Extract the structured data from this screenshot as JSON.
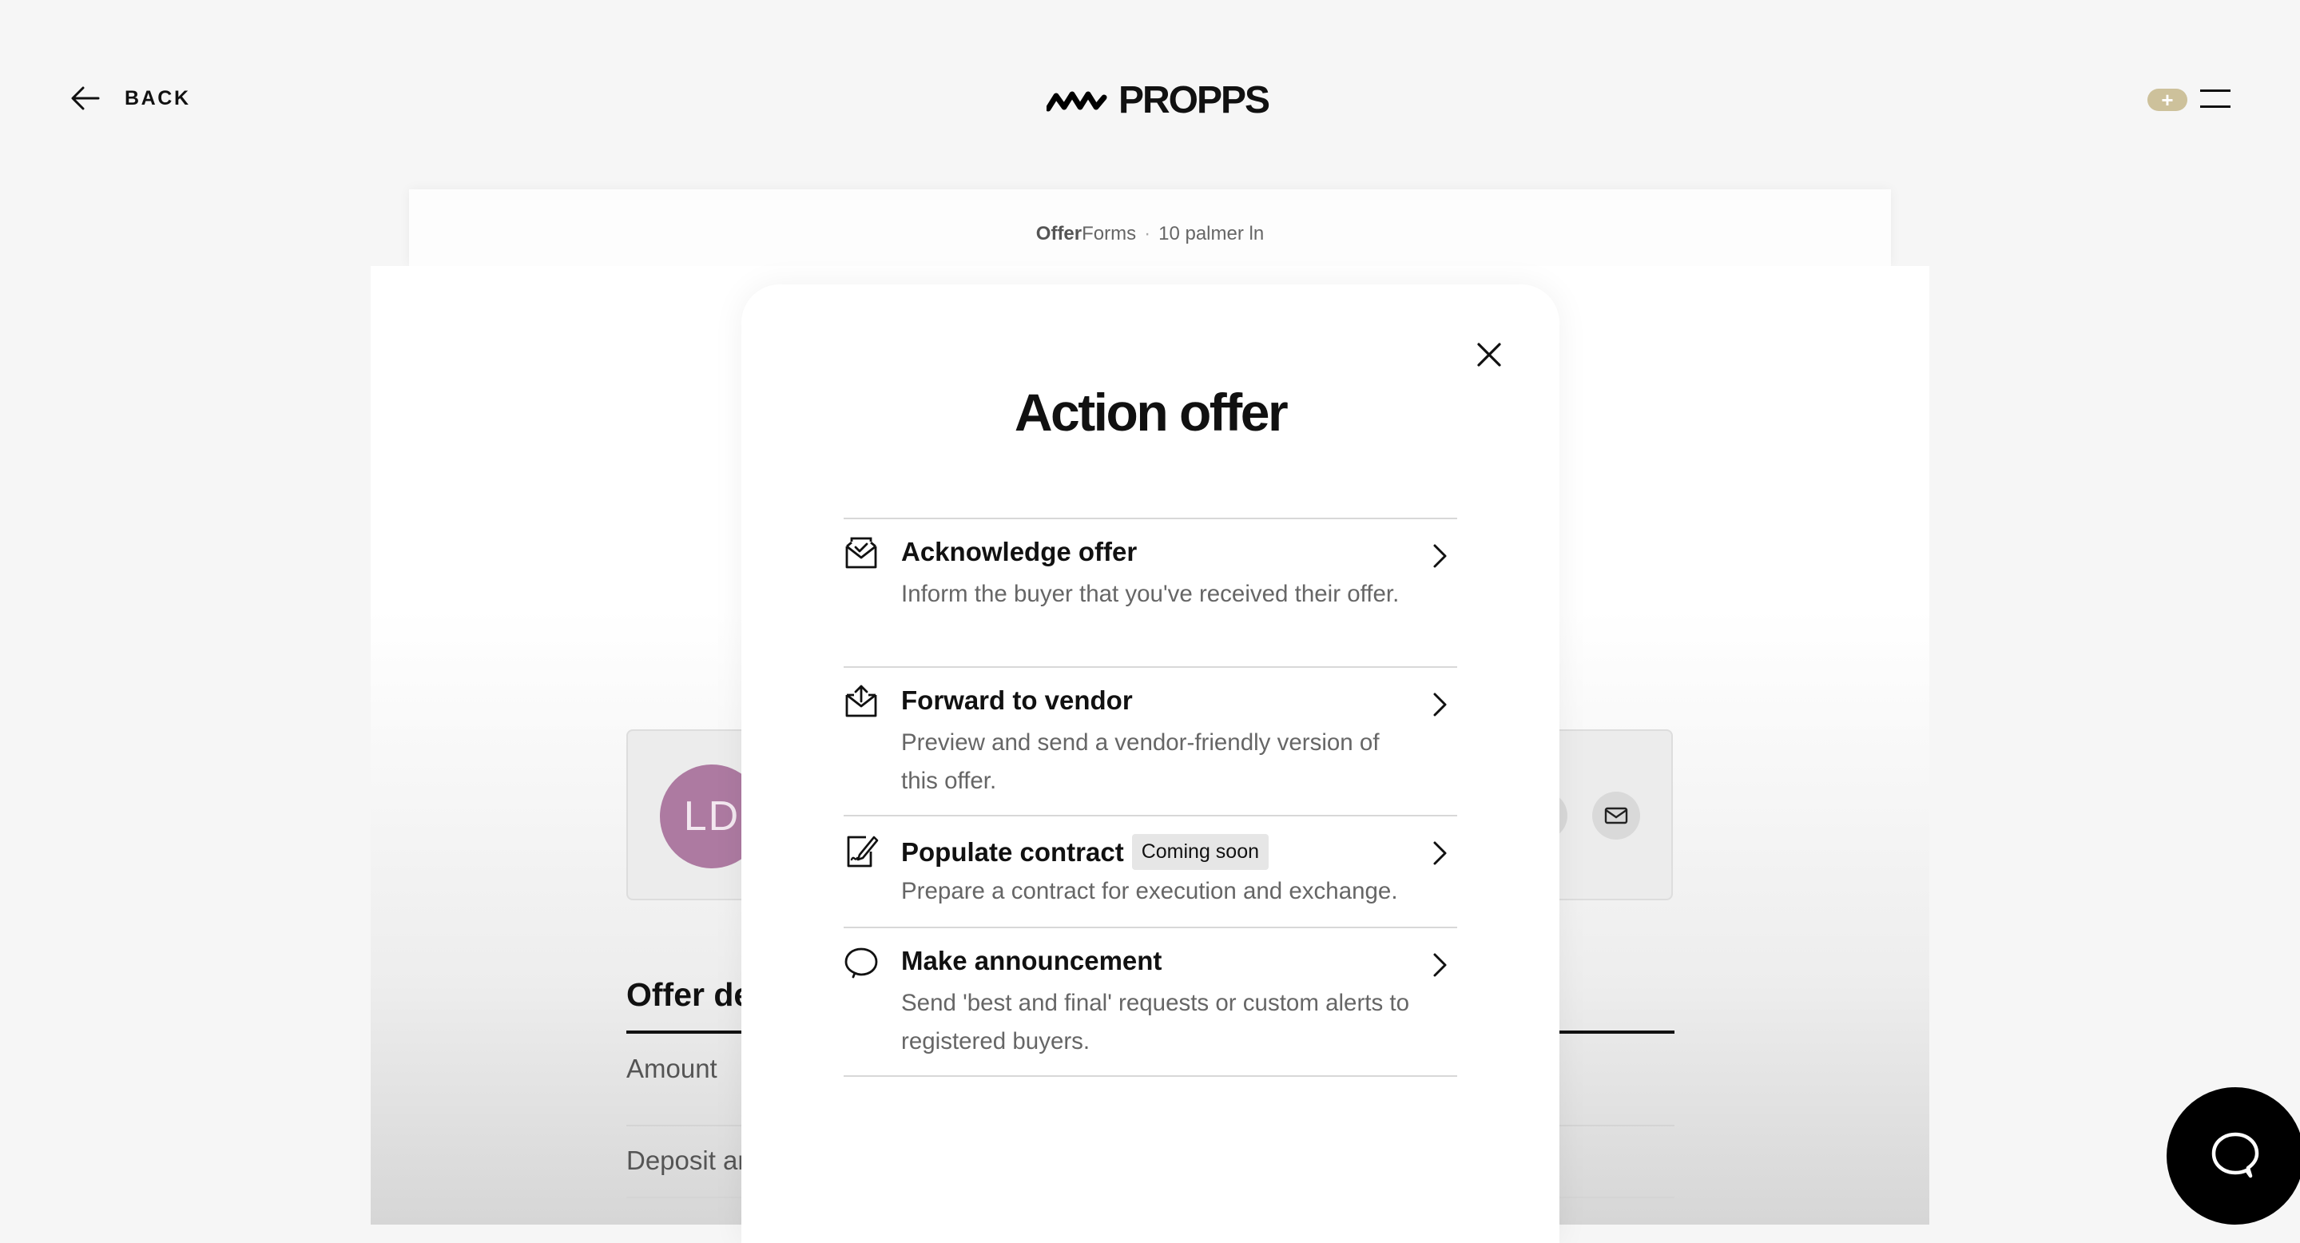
{
  "header": {
    "back_label": "BACK",
    "logo_text": "PROPPS",
    "add_symbol": "+",
    "accent_color": "#cdc19b"
  },
  "breadcrumb": {
    "brand_bold": "Offer",
    "brand_rest": "Forms",
    "separator": "·",
    "address": "10 palmer ln"
  },
  "background_page": {
    "avatar_initials": "LD",
    "avatar_color": "#ad7aa1",
    "section_heading": "Offer de",
    "rows": [
      "Amount",
      "Deposit ar"
    ],
    "contact_icons": [
      "phone-icon",
      "mail-icon"
    ]
  },
  "modal": {
    "title": "Action offer",
    "actions": [
      {
        "icon": "envelope-check-icon",
        "title": "Acknowledge offer",
        "badge": "",
        "description": "Inform the buyer that you've received their offer."
      },
      {
        "icon": "envelope-upload-icon",
        "title": "Forward to vendor",
        "badge": "",
        "description": "Preview and send a vendor-friendly version of this offer."
      },
      {
        "icon": "contract-sign-icon",
        "title": "Populate contract",
        "badge": "Coming soon",
        "description": "Prepare a contract for execution and exchange."
      },
      {
        "icon": "speech-bubble-icon",
        "title": "Make announcement",
        "badge": "",
        "description": "Send 'best and final' requests or custom alerts to registered buyers."
      }
    ]
  },
  "chat": {
    "icon": "chat-bubble-icon"
  }
}
